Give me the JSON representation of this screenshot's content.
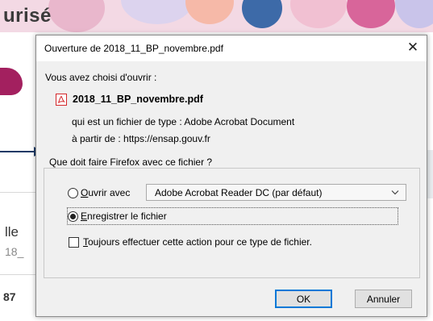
{
  "background": {
    "banner_title": "urisé",
    "text_fragment_1": "lle",
    "text_fragment_2": "18_",
    "text_fragment_3": "87",
    "colors": {
      "banner": "#f3d9e4",
      "accent_magenta": "#a3205f",
      "arrow": "#1d3a66"
    }
  },
  "dialog": {
    "title": "Ouverture de 2018_11_BP_novembre.pdf",
    "close_glyph": "✕",
    "intro": "Vous avez choisi d'ouvrir :",
    "file_icon": "pdf-icon",
    "filename": "2018_11_BP_novembre.pdf",
    "type_line": "qui est un fichier de type :  Adobe Acrobat Document",
    "source_line": "à partir de :  https://ensap.gouv.fr",
    "group_title": "Que doit faire Firefox avec ce fichier ?",
    "open_with": {
      "label_accel": "O",
      "label_rest": "uvrir avec",
      "checked": false
    },
    "app_select": {
      "value": "Adobe Acrobat Reader DC  (par défaut)"
    },
    "save_file": {
      "label_accel": "E",
      "label_rest": "nregistrer le fichier",
      "checked": true
    },
    "always": {
      "label_accel": "T",
      "label_rest": "oujours effectuer cette action pour ce type de fichier.",
      "checked": false
    },
    "ok_label": "OK",
    "cancel_label": "Annuler",
    "colors": {
      "pdf_icon": "#d4272b",
      "default_button_border": "#0078d7",
      "dialog_bg": "#f0f0f0"
    }
  }
}
